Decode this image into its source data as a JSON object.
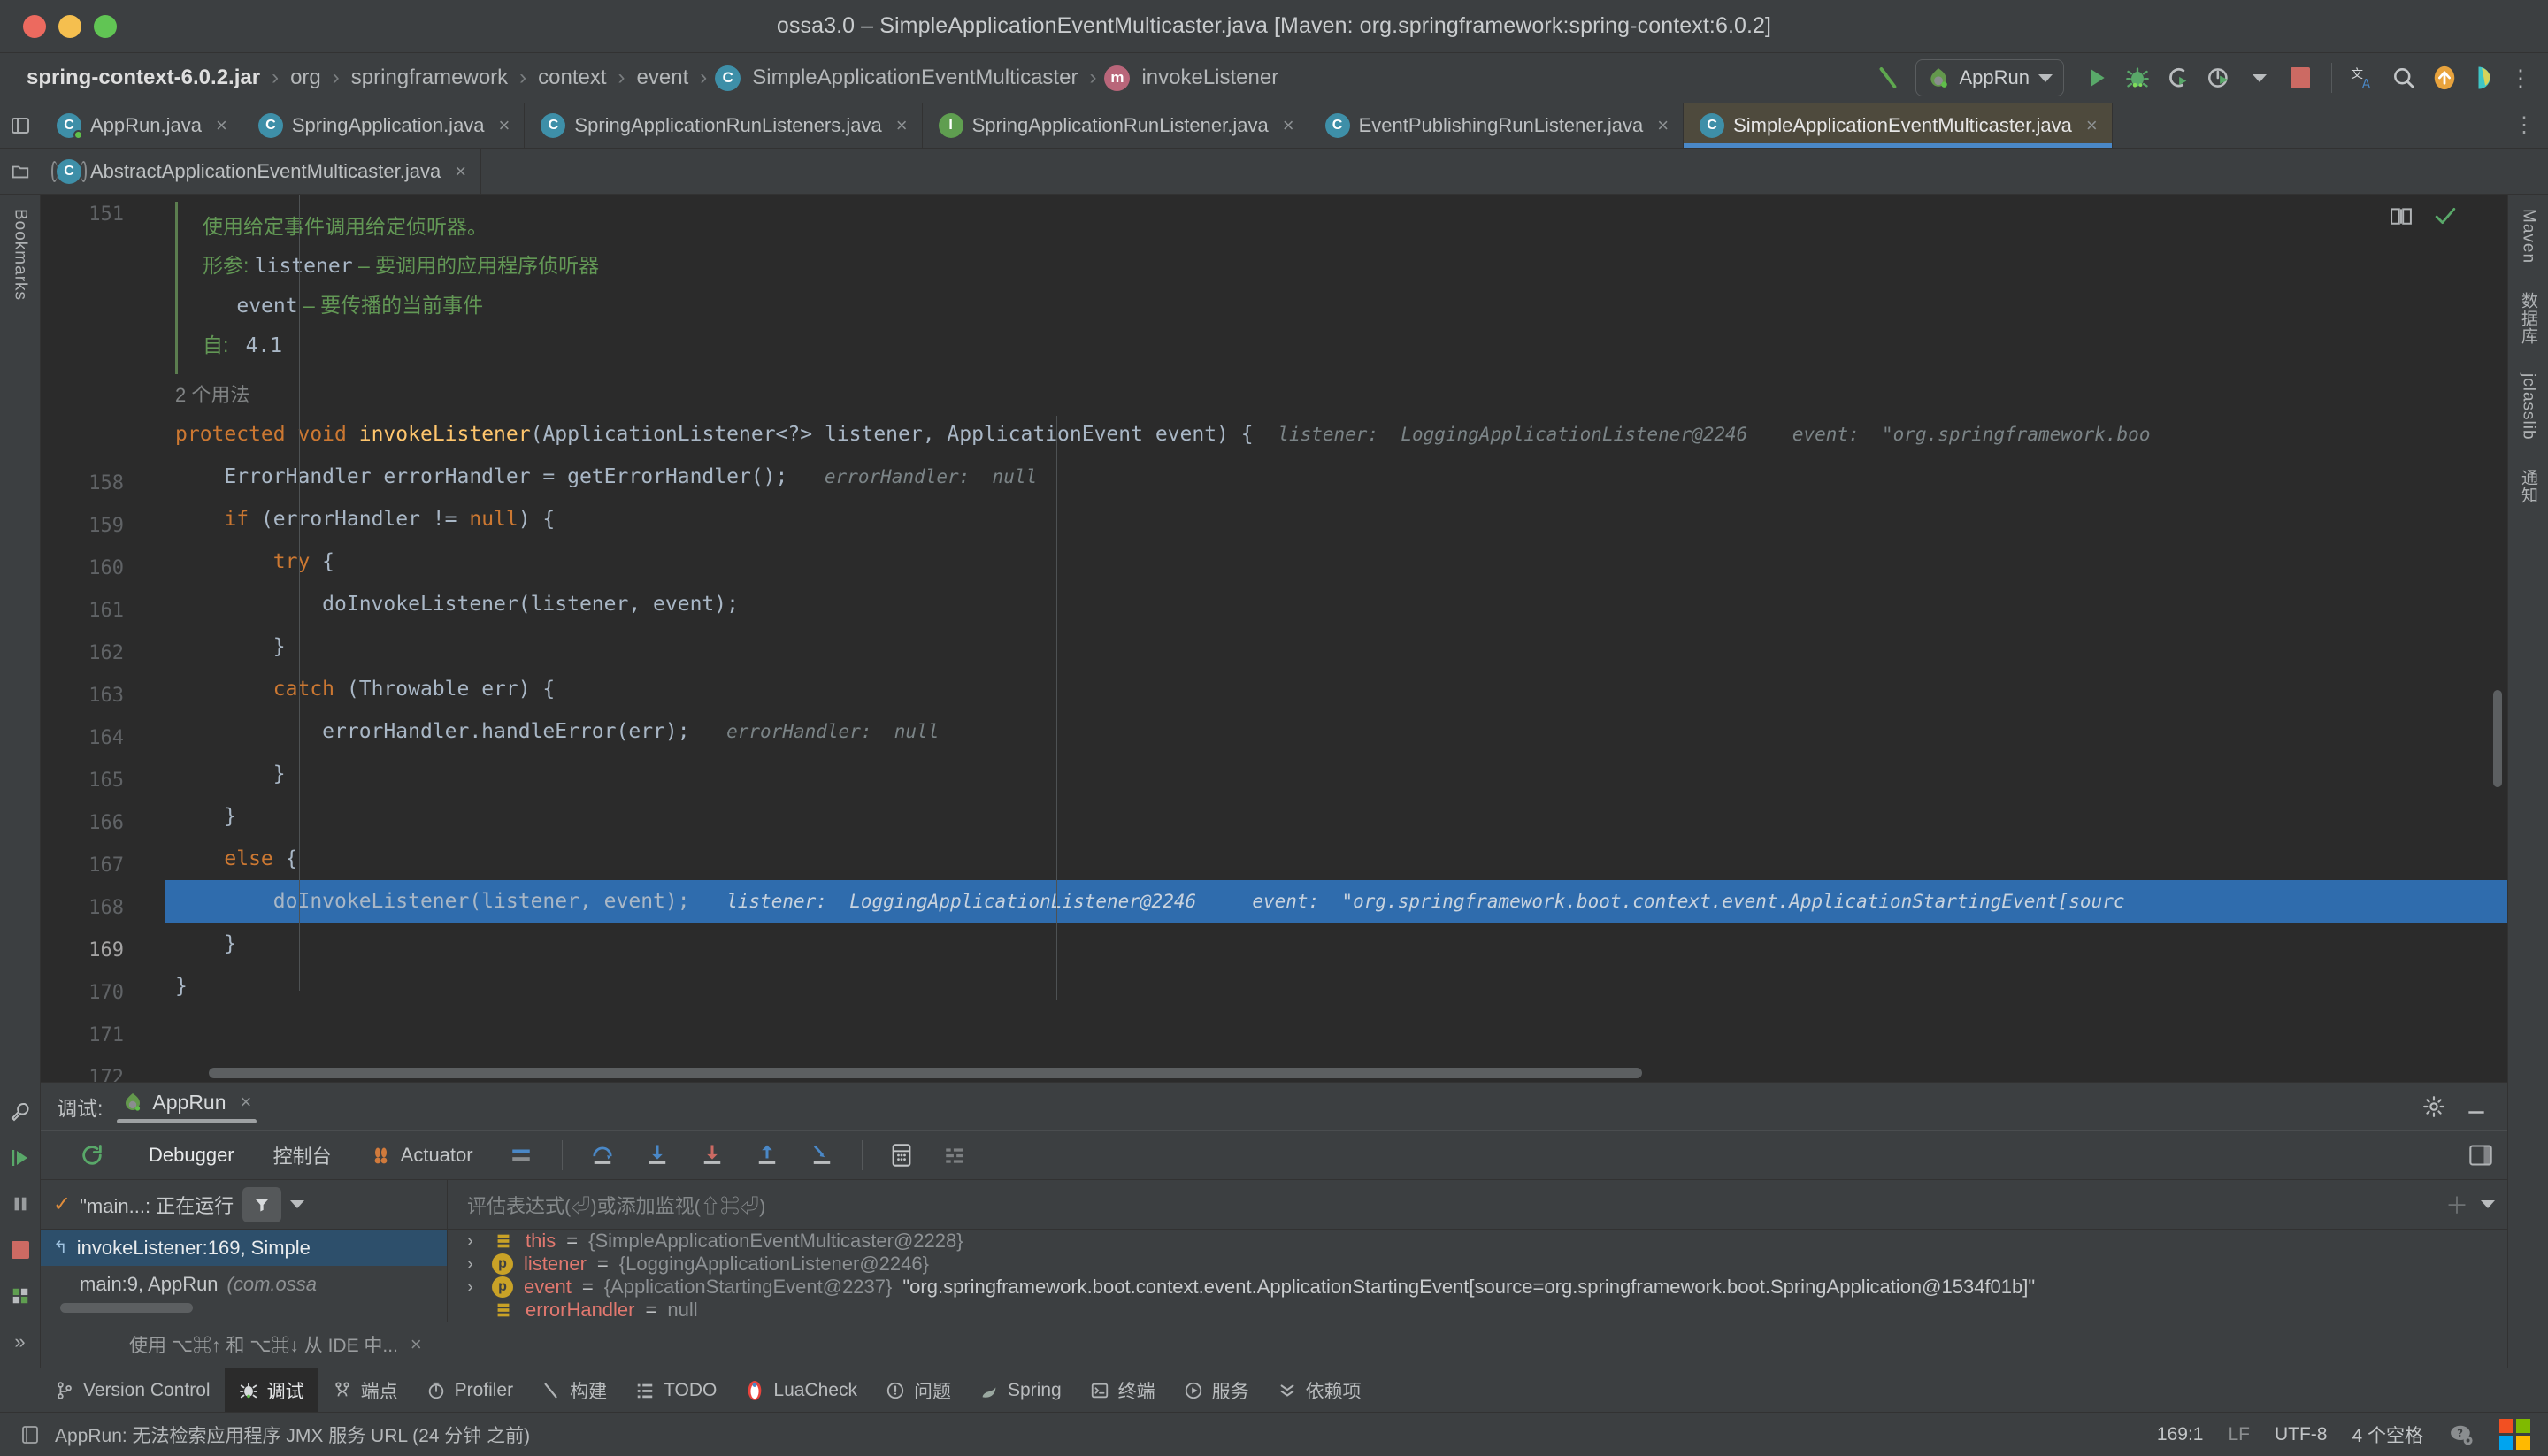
{
  "window": {
    "title": "ossa3.0 – SimpleApplicationEventMulticaster.java [Maven: org.springframework:spring-context:6.0.2]",
    "traffic": {
      "close": "close-window",
      "minimize": "minimize-window",
      "zoom": "zoom-window"
    }
  },
  "breadcrumb": {
    "items": [
      {
        "label": "spring-context-6.0.2.jar",
        "icon": ""
      },
      {
        "label": "org",
        "icon": ""
      },
      {
        "label": "springframework",
        "icon": ""
      },
      {
        "label": "context",
        "icon": ""
      },
      {
        "label": "event",
        "icon": ""
      },
      {
        "label": "SimpleApplicationEventMulticaster",
        "icon": "class-icon"
      },
      {
        "label": "invokeListener",
        "icon": "method-icon"
      }
    ],
    "separator": "›"
  },
  "navtools": {
    "build_icon": "hammer-icon",
    "run_config": {
      "label": "AppRun",
      "icon": "spring-boot-run-icon",
      "caret": "chevron-down-icon"
    },
    "run_icon": "run-icon",
    "debug_icon": "debug-icon",
    "run_coverage_icon": "run-with-coverage-icon",
    "profiler_icon": "profiler-icon",
    "profiler_caret": "chevron-down-icon",
    "stop_icon": "stop-icon",
    "translate_icon": "translate-icon",
    "search_icon": "search-icon",
    "updates_icon": "update-available-icon",
    "ide_icon": "ide-logo-icon",
    "settings_icon": "more-options-icon"
  },
  "tabs": {
    "row1": [
      {
        "label": "AppRun.java",
        "icon": "class-run-icon",
        "active": false
      },
      {
        "label": "SpringApplication.java",
        "icon": "class-icon",
        "active": false
      },
      {
        "label": "SpringApplicationRunListeners.java",
        "icon": "class-icon",
        "active": false
      },
      {
        "label": "SpringApplicationRunListener.java",
        "icon": "interface-icon",
        "active": false
      },
      {
        "label": "EventPublishingRunListener.java",
        "icon": "class-icon",
        "active": false
      },
      {
        "label": "SimpleApplicationEventMulticaster.java",
        "icon": "class-icon",
        "active": true
      }
    ],
    "row2": [
      {
        "label": "AbstractApplicationEventMulticaster.java",
        "icon": "abstract-class-icon",
        "active": false
      }
    ],
    "close_glyph": "×",
    "more_glyph": "⋮"
  },
  "editor": {
    "doc": {
      "summary": "使用给定事件调用给定侦听器。",
      "params_label": "形参:",
      "params": [
        {
          "name": "listener",
          "dash": "–",
          "desc": "要调用的应用程序侦听器"
        },
        {
          "name": "event",
          "dash": "–",
          "desc": "要传播的当前事件"
        }
      ],
      "since_label": "自:",
      "since_value": "4.1"
    },
    "usages": "2 个用法",
    "first_visible_line": "151",
    "lines": [
      {
        "num": "158",
        "fold": "−",
        "code": "protected void invokeListener(ApplicationListener<?> listener, ApplicationEvent event) {",
        "hint": "listener:  LoggingApplicationListener@2246    event:  \"org.springframework.boo",
        "highlight": false
      },
      {
        "num": "159",
        "fold": "",
        "code": "    ErrorHandler errorHandler = getErrorHandler();",
        "hint": "errorHandler:  null",
        "highlight": false
      },
      {
        "num": "160",
        "fold": "−",
        "code": "    if (errorHandler != null) {",
        "hint": "",
        "highlight": false
      },
      {
        "num": "161",
        "fold": "−",
        "code": "        try {",
        "hint": "",
        "highlight": false
      },
      {
        "num": "162",
        "fold": "",
        "code": "            doInvokeListener(listener, event);",
        "hint": "",
        "highlight": false
      },
      {
        "num": "163",
        "fold": "",
        "code": "        }",
        "hint": "",
        "highlight": false
      },
      {
        "num": "164",
        "fold": "−",
        "code": "        catch (Throwable err) {",
        "hint": "",
        "highlight": false
      },
      {
        "num": "165",
        "fold": "",
        "code": "            errorHandler.handleError(err);",
        "hint": "errorHandler:  null",
        "highlight": false
      },
      {
        "num": "166",
        "fold": "",
        "code": "        }",
        "hint": "",
        "highlight": false
      },
      {
        "num": "167",
        "fold": "−",
        "code": "    }",
        "hint": "",
        "highlight": false
      },
      {
        "num": "168",
        "fold": "−",
        "code": "    else {",
        "hint": "",
        "highlight": false
      },
      {
        "num": "169",
        "fold": "",
        "code": "        doInvokeListener(listener, event);",
        "hint": "listener:  LoggingApplicationListener@2246     event:  \"org.springframework.boot.context.event.ApplicationStartingEvent[sourc",
        "highlight": true
      },
      {
        "num": "170",
        "fold": "",
        "code": "    }",
        "hint": "",
        "highlight": false
      },
      {
        "num": "171",
        "fold": "−",
        "code": "}",
        "hint": "",
        "highlight": false
      },
      {
        "num": "172",
        "fold": "",
        "code": "",
        "hint": "",
        "highlight": false
      }
    ],
    "reader_mode_icon": "reader-mode-icon",
    "inspections_ok_icon": "inspections-ok-icon"
  },
  "debug": {
    "title_label": "调试:",
    "session_tab": "AppRun",
    "session_icon": "spring-boot-icon",
    "settings_icon": "gear-icon",
    "minimize_icon": "minimize-icon",
    "layout_icon": "layout-settings-icon",
    "restart_icon": "rerun-icon",
    "tabs": [
      {
        "label": "Debugger",
        "icon": "",
        "selected": true
      },
      {
        "label": "控制台",
        "icon": "",
        "selected": false
      },
      {
        "label": "Actuator",
        "icon": "actuator-icon",
        "selected": false
      }
    ],
    "stepping": {
      "mute_breakpoints_icon": "mute-breakpoints-icon",
      "step_over_icon": "step-over-icon",
      "step_into_icon": "step-into-icon",
      "force_step_into_icon": "force-step-into-icon",
      "step_out_icon": "step-out-icon",
      "run_to_cursor_icon": "run-to-cursor-icon",
      "evaluate_icon": "evaluate-expression-icon",
      "threads_icon": "threads-view-icon"
    },
    "frames": {
      "thread_label": "\"main...: 正在运行",
      "thread_check_icon": "check-icon",
      "filter_icon": "filter-icon",
      "dropdown_icon": "chevron-down-icon",
      "items": [
        {
          "name": "invokeListener:169, Simple",
          "pkg": "",
          "selected": true,
          "icon": "frame-icon"
        },
        {
          "name": "main:9, AppRun",
          "pkg": "(com.ossa",
          "selected": false,
          "icon": ""
        }
      ]
    },
    "watch_placeholder": "评估表达式(⏎)或添加监视(⇧⌘⏎)",
    "add_watch_icon": "add-icon",
    "watch_menu_icon": "chevron-down-icon",
    "variables": [
      {
        "chevron": "›",
        "icon": "object-icon",
        "name": "this",
        "eq": "=",
        "value": "{SimpleApplicationEventMulticaster@2228}",
        "extra": ""
      },
      {
        "chevron": "›",
        "icon": "parameter-icon",
        "name": "listener",
        "eq": "=",
        "value": "{LoggingApplicationListener@2246}",
        "extra": ""
      },
      {
        "chevron": "›",
        "icon": "parameter-icon",
        "name": "event",
        "eq": "=",
        "value": "{ApplicationStartingEvent@2237}",
        "extra": "\"org.springframework.boot.context.event.ApplicationStartingEvent[source=org.springframework.boot.SpringApplication@1534f01b]\""
      },
      {
        "chevron": "",
        "icon": "object-icon",
        "name": "errorHandler",
        "eq": "=",
        "value": "null",
        "extra": ""
      }
    ],
    "hint_bar": {
      "text": "使用 ⌥⌘↑ 和 ⌥⌘↓ 从 IDE 中...",
      "close_glyph": "×"
    }
  },
  "tool_window_bar": [
    {
      "label": "Version Control",
      "icon": "version-control-icon",
      "active": false
    },
    {
      "label": "调试",
      "icon": "debug-icon",
      "active": true
    },
    {
      "label": "端点",
      "icon": "endpoints-icon",
      "active": false
    },
    {
      "label": "Profiler",
      "icon": "profiler-icon",
      "active": false
    },
    {
      "label": "构建",
      "icon": "build-icon",
      "active": false
    },
    {
      "label": "TODO",
      "icon": "todo-icon",
      "active": false
    },
    {
      "label": "LuaCheck",
      "icon": "luacheck-icon",
      "active": false
    },
    {
      "label": "问题",
      "icon": "problems-icon",
      "active": false
    },
    {
      "label": "Spring",
      "icon": "spring-icon",
      "active": false
    },
    {
      "label": "终端",
      "icon": "terminal-icon",
      "active": false
    },
    {
      "label": "服务",
      "icon": "services-icon",
      "active": false
    },
    {
      "label": "依赖项",
      "icon": "dependencies-icon",
      "active": false
    }
  ],
  "left_rail": {
    "top_icons": [
      "project-icon",
      "folder-icon"
    ],
    "labels": [
      "Bookmarks"
    ],
    "bottom_icons": [
      "run-icon",
      "pause-icon",
      "stop-icon",
      "layout-icon",
      "expand-icon"
    ]
  },
  "right_rail": {
    "labels": [
      "Maven",
      "数据库",
      "jclasslib",
      "通知"
    ],
    "icons": [
      "maven-icon",
      "database-icon",
      "jclasslib-icon",
      "notifications-icon"
    ]
  },
  "status_bar": {
    "icon": "event-log-icon",
    "message": "AppRun: 无法检索应用程序 JMX 服务 URL (24 分钟 之前)",
    "caret_position": "169:1",
    "line_separator": "LF",
    "encoding": "UTF-8",
    "indent": "4 个空格",
    "help_icon": "help-settings-icon",
    "os_icon": "windows-logo-icon"
  },
  "colors": {
    "accent_blue": "#4a88c7",
    "editor_bg": "#2b2b2b",
    "chrome_bg": "#3c3f41",
    "active_tab_bg": "#4e4a3d",
    "highlight_line": "#2f6cad",
    "keyword": "#cc7832",
    "method": "#ffc66d",
    "doc_green": "#629755",
    "var_name": "#e1786f"
  }
}
